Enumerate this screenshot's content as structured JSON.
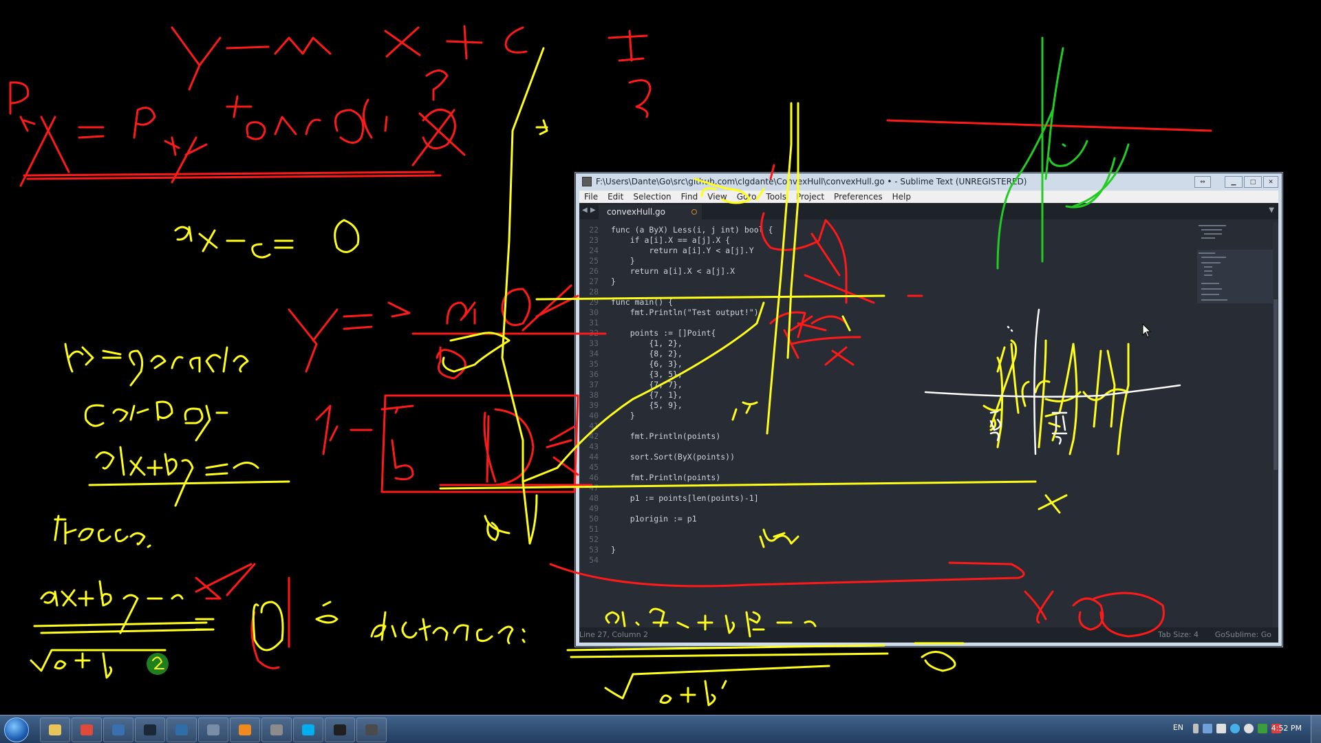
{
  "window": {
    "title": "F:\\Users\\Dante\\Go\\src\\github.com\\clgdante\\ConvexHull\\convexHull.go • - Sublime Text (UNREGISTERED)",
    "menu": [
      "File",
      "Edit",
      "Selection",
      "Find",
      "View",
      "Goto",
      "Tools",
      "Project",
      "Preferences",
      "Help"
    ],
    "tab": "convexHull.go",
    "code": [
      {
        "n": "22",
        "t": "func (a ByX) Less(i, j int) bool {"
      },
      {
        "n": "23",
        "t": "    if a[i].X == a[j].X {"
      },
      {
        "n": "24",
        "t": "        return a[i].Y < a[j].Y"
      },
      {
        "n": "25",
        "t": "    }"
      },
      {
        "n": "26",
        "t": "    return a[i].X < a[j].X"
      },
      {
        "n": "27",
        "t": "}"
      },
      {
        "n": "28",
        "t": ""
      },
      {
        "n": "29",
        "t": "func main() {"
      },
      {
        "n": "30",
        "t": "    fmt.Println(\"Test output!\")"
      },
      {
        "n": "31",
        "t": ""
      },
      {
        "n": "32",
        "t": "    points := []Point{"
      },
      {
        "n": "33",
        "t": "        {1, 2},"
      },
      {
        "n": "34",
        "t": "        {8, 2},"
      },
      {
        "n": "35",
        "t": "        {6, 3},"
      },
      {
        "n": "36",
        "t": "        {3, 5},"
      },
      {
        "n": "37",
        "t": "        {7, 7},"
      },
      {
        "n": "38",
        "t": "        {7, 1},"
      },
      {
        "n": "39",
        "t": "        {5, 9},"
      },
      {
        "n": "40",
        "t": "    }"
      },
      {
        "n": "41",
        "t": ""
      },
      {
        "n": "42",
        "t": "    fmt.Println(points)"
      },
      {
        "n": "43",
        "t": ""
      },
      {
        "n": "44",
        "t": "    sort.Sort(ByX(points))"
      },
      {
        "n": "45",
        "t": ""
      },
      {
        "n": "46",
        "t": "    fmt.Println(points)"
      },
      {
        "n": "47",
        "t": ""
      },
      {
        "n": "48",
        "t": "    p1 := points[len(points)-1]"
      },
      {
        "n": "49",
        "t": ""
      },
      {
        "n": "50",
        "t": "    p1origin := p1"
      },
      {
        "n": "51",
        "t": ""
      },
      {
        "n": "52",
        "t": ""
      },
      {
        "n": "53",
        "t": "}"
      },
      {
        "n": "54",
        "t": ""
      }
    ],
    "status_left": "Line 27, Column 2",
    "status_tab": "Tab Size: 4",
    "status_syntax": "GoSublime: Go"
  },
  "handwriting": [
    "y = m x + c",
    "1",
    "?",
    "P2",
    "y = P1 + tan(α) · x",
    "y",
    "?",
    "ax - c = 0",
    "y = - c/b - a/b x",
    "P1",
    "b",
    "b2 = gerade",
    "Gerade:",
    "ax+by=c",
    "Hesse:",
    "ax+by-c",
    "√(a²+b²)",
    "= 0",
    "→",
    "distance:",
    "a·P2x + b P2y - c",
    "√(a²+b²)",
    "0",
    "Px",
    "x",
    "1/2",
    "π/2",
    "Π",
    "Δx"
  ],
  "taskbar": {
    "apps": [
      "explorer",
      "chrome",
      "steam-console",
      "steam",
      "sourcetree",
      "virtualbox",
      "vlc",
      "audio",
      "skype",
      "cmd",
      "sublime"
    ],
    "language": "EN",
    "clock": "4:52 PM"
  },
  "colors": {
    "ink_red": "#ff1a1a",
    "ink_yellow": "#ffff1a",
    "ink_green": "#22cc22",
    "ink_white": "#ffffff"
  }
}
